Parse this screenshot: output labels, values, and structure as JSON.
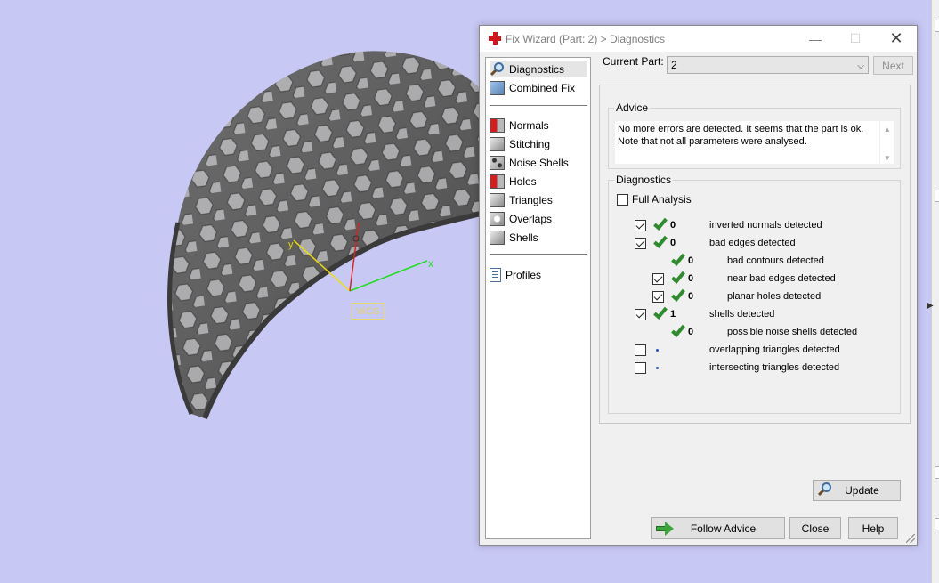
{
  "viewport": {
    "wcs_label": "WCS",
    "axis_x_label": "x",
    "axis_y_label": "y",
    "background": "#c8c8f5"
  },
  "dialog": {
    "title": "Fix Wizard (Part: 2) > Diagnostics",
    "window_buttons": {
      "minimize": "—",
      "maximize": "☐",
      "close": "✕"
    },
    "nav": {
      "group1": [
        {
          "label": "Diagnostics",
          "icon": "magnifier-icon",
          "selected": true
        },
        {
          "label": "Combined Fix",
          "icon": "combined-fix-icon"
        }
      ],
      "group2": [
        {
          "label": "Normals",
          "icon": "normals-icon"
        },
        {
          "label": "Stitching",
          "icon": "stitching-icon"
        },
        {
          "label": "Noise Shells",
          "icon": "noise-shells-icon"
        },
        {
          "label": "Holes",
          "icon": "holes-icon"
        },
        {
          "label": "Triangles",
          "icon": "triangles-icon"
        },
        {
          "label": "Overlaps",
          "icon": "overlaps-icon"
        },
        {
          "label": "Shells",
          "icon": "shells-icon"
        }
      ],
      "group3": [
        {
          "label": "Profiles",
          "icon": "profiles-icon"
        }
      ]
    },
    "current_part_label": "Current Part:",
    "current_part_value": "2",
    "next_label": "Next",
    "advice": {
      "title": "Advice",
      "text": "No more errors are detected. It seems that the part is ok. Note that not all parameters were analysed."
    },
    "diagnostics": {
      "title": "Diagnostics",
      "full_analysis_label": "Full Analysis",
      "full_analysis_checked": false,
      "rows": [
        {
          "checkbox": true,
          "checked": true,
          "status": "ok",
          "count": "0",
          "label": "inverted normals detected",
          "indent": 0
        },
        {
          "checkbox": true,
          "checked": true,
          "status": "ok",
          "count": "0",
          "label": "bad edges detected",
          "indent": 0
        },
        {
          "checkbox": false,
          "checked": false,
          "status": "ok",
          "count": "0",
          "label": "bad contours detected",
          "indent": 1
        },
        {
          "checkbox": true,
          "checked": true,
          "status": "ok",
          "count": "0",
          "label": "near bad edges detected",
          "indent": 1
        },
        {
          "checkbox": true,
          "checked": true,
          "status": "ok",
          "count": "0",
          "label": "planar holes detected",
          "indent": 1
        },
        {
          "checkbox": true,
          "checked": true,
          "status": "ok",
          "count": "1",
          "label": "shells detected",
          "indent": 0
        },
        {
          "checkbox": false,
          "checked": false,
          "status": "ok",
          "count": "0",
          "label": "possible noise shells detected",
          "indent": 1
        },
        {
          "checkbox": true,
          "checked": false,
          "status": "none",
          "count": "",
          "label": "overlapping triangles detected",
          "indent": 0
        },
        {
          "checkbox": true,
          "checked": false,
          "status": "none",
          "count": "",
          "label": "intersecting triangles detected",
          "indent": 0
        }
      ],
      "update_label": "Update"
    },
    "buttons": {
      "follow_advice": "Follow Advice",
      "close": "Close",
      "help": "Help"
    },
    "colors": {
      "check_green": "#2e8b2e",
      "close_cross_red": "#d4161c"
    }
  }
}
